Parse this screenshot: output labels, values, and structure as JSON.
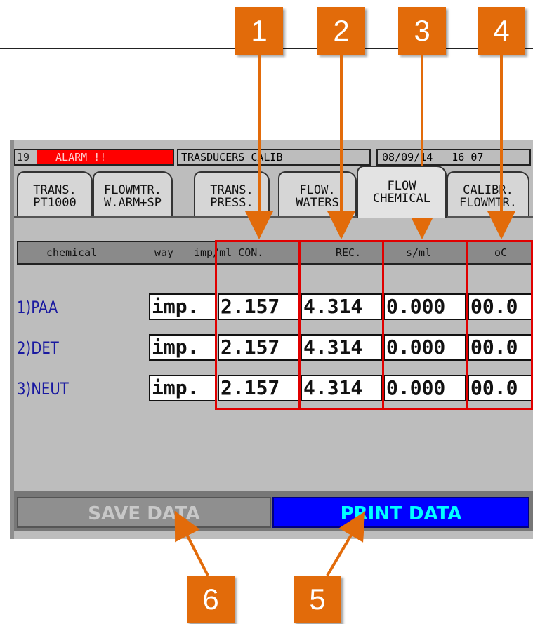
{
  "callouts": {
    "c1": "1",
    "c2": "2",
    "c3": "3",
    "c4": "4",
    "c5": "5",
    "c6": "6"
  },
  "status": {
    "id": "19",
    "alarm": "ALARM !!",
    "title": "TRASDUCERS CALIB",
    "date": "08/09/14",
    "time": "16 07"
  },
  "tabs": [
    {
      "line1": "TRANS.",
      "line2": "PT1000"
    },
    {
      "line1": "FLOWMTR.",
      "line2": "W.ARM+SP"
    },
    {
      "line1": "TRANS.",
      "line2": "PRESS."
    },
    {
      "line1": "FLOW.",
      "line2": "WATERS"
    },
    {
      "line1": "FLOW",
      "line2": "CHEMICAL"
    },
    {
      "line1": "CALIBR.",
      "line2": "FLOWMTR."
    }
  ],
  "header": {
    "chemical": "chemical",
    "way": "way",
    "imp_ml": "imp/ml CON.",
    "rec": "REC.",
    "s_ml": "s/ml",
    "oc": "oC"
  },
  "rows": [
    {
      "label": "1)PAA",
      "way": "imp.",
      "con": "2.157",
      "rec": "4.314",
      "sml": "0.000",
      "oc": "00.0"
    },
    {
      "label": "2)DET",
      "way": "imp.",
      "con": "2.157",
      "rec": "4.314",
      "sml": "0.000",
      "oc": "00.0"
    },
    {
      "label": "3)NEUT",
      "way": "imp.",
      "con": "2.157",
      "rec": "4.314",
      "sml": "0.000",
      "oc": "00.0"
    }
  ],
  "buttons": {
    "save": "SAVE DATA",
    "print": "PRINT DATA"
  },
  "colors": {
    "callout": "#e26b0a",
    "alarm_bg": "#ff0000",
    "print_bg": "#0000ff",
    "print_fg": "#00ffff",
    "row_label": "#1a1aa0",
    "highlight": "#e00000"
  }
}
